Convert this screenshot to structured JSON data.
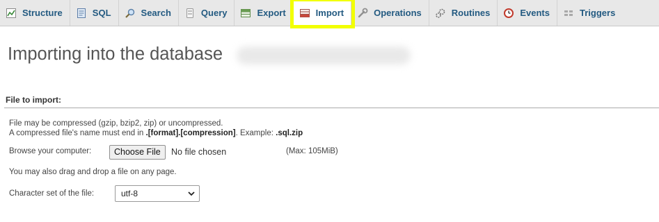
{
  "tabs": [
    {
      "label": "Structure",
      "icon": "structure-icon",
      "active": false
    },
    {
      "label": "SQL",
      "icon": "sql-icon",
      "active": false
    },
    {
      "label": "Search",
      "icon": "search-icon",
      "active": false
    },
    {
      "label": "Query",
      "icon": "query-icon",
      "active": false
    },
    {
      "label": "Export",
      "icon": "export-icon",
      "active": false
    },
    {
      "label": "Import",
      "icon": "import-icon",
      "active": true
    },
    {
      "label": "Operations",
      "icon": "operations-icon",
      "active": false
    },
    {
      "label": "Routines",
      "icon": "routines-icon",
      "active": false
    },
    {
      "label": "Events",
      "icon": "events-icon",
      "active": false
    },
    {
      "label": "Triggers",
      "icon": "triggers-icon",
      "active": false
    }
  ],
  "page": {
    "title": "Importing into the database",
    "database_name_redacted": true
  },
  "file_section": {
    "legend": "File to import:",
    "compress_note": "File may be compressed (gzip, bzip2, zip) or uncompressed.",
    "name_note_prefix": "A compressed file's name must end in ",
    "name_note_format": ".[format].[compression]",
    "name_note_middle": ". Example: ",
    "name_note_example": ".sql.zip",
    "browse_label": "Browse your computer:",
    "choose_button": "Choose File",
    "no_file_text": "No file chosen",
    "max_size": "(Max: 105MiB)",
    "drag_note": "You may also drag and drop a file on any page.",
    "charset_label": "Character set of the file:",
    "charset_value": "utf-8"
  },
  "colors": {
    "tab_text": "#235a81",
    "highlight": "#f2ff00",
    "tab_bar": "#e8e8e8"
  }
}
